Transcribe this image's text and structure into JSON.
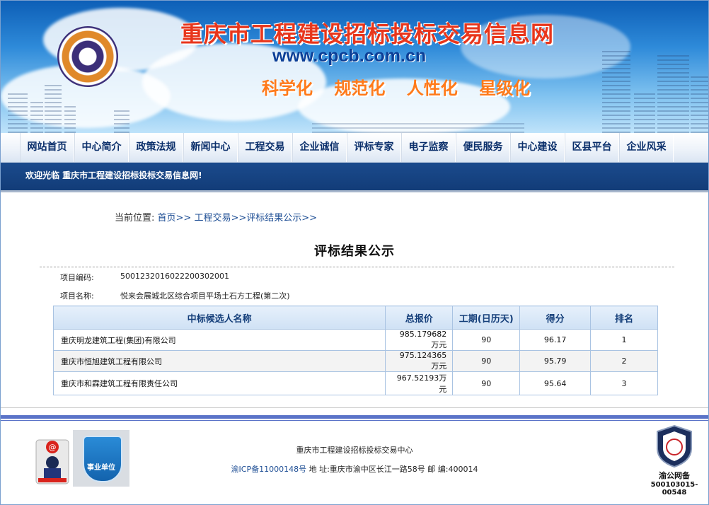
{
  "header": {
    "site_title": "重庆市工程建设招标投标交易信息网",
    "site_url": "www.cpcb.com.cn",
    "slogans": [
      "科学化",
      "规范化",
      "人性化",
      "星级化"
    ]
  },
  "nav": {
    "items": [
      "网站首页",
      "中心简介",
      "政策法规",
      "新闻中心",
      "工程交易",
      "企业诚信",
      "评标专家",
      "电子监察",
      "便民服务",
      "中心建设",
      "区县平台",
      "企业风采"
    ]
  },
  "welcome": "欢迎光临 重庆市工程建设招标投标交易信息网!",
  "breadcrumb": {
    "label": "当前位置:",
    "home": "首页>>",
    "section": "工程交易>>评标结果公示>>"
  },
  "page_title": "评标结果公示",
  "project": {
    "code_label": "项目编码:",
    "code": "5001232016022200302001",
    "name_label": "项目名称:",
    "name": "悦来会展城北区综合项目平场土石方工程(第二次)"
  },
  "table": {
    "headers": [
      "中标候选人名称",
      "总报价",
      "工期(日历天)",
      "得分",
      "排名"
    ],
    "rows": [
      [
        "重庆明龙建筑工程(集团)有限公司",
        "985.179682万元",
        "90",
        "96.17",
        "1"
      ],
      [
        "重庆市恒旭建筑工程有限公司",
        "975.124365万元",
        "90",
        "95.79",
        "2"
      ],
      [
        "重庆市和霖建筑工程有限责任公司",
        "967.52193万元",
        "90",
        "95.64",
        "3"
      ]
    ]
  },
  "footer": {
    "org": "重庆市工程建设招标投标交易中心",
    "icp": "渝ICP备11000148号",
    "address": "地 址:重庆市渝中区长江一路58号 邮 编:400014",
    "shiye_label": "事业单位",
    "police_label": "渝公网备",
    "police_number": "500103015-00548"
  },
  "colors": {
    "nav_text": "#0b2f6b",
    "welcome_bar": "#143e7b",
    "title_red": "#e8361c",
    "slogan_orange": "#ff7a1a",
    "footer_rule": "#5a73c8"
  }
}
